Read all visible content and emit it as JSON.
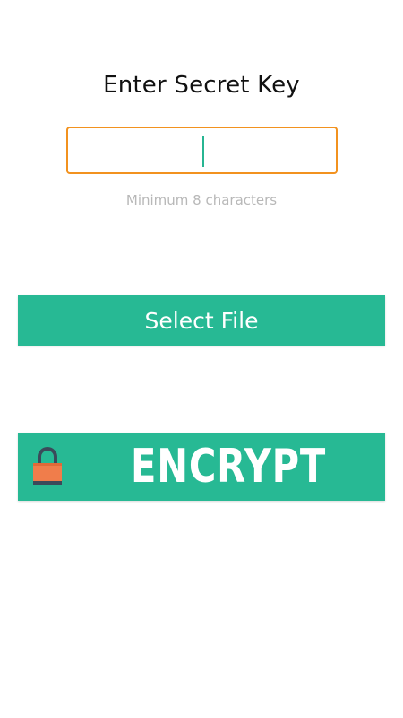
{
  "screen": {
    "title": "Enter Secret Key",
    "key_input": {
      "value": "",
      "placeholder": ""
    },
    "hint": "Minimum 8 characters",
    "select_file_label": "Select File",
    "encrypt_label": "ENCRYPT",
    "encrypt_icon": "padlock-icon"
  },
  "colors": {
    "background": "#ffffff",
    "accent_green": "#27b994",
    "input_border_orange": "#f2921f",
    "lock_body": "#f07d4b",
    "lock_shackle": "#3b4a5a",
    "hint_text": "#b8b8b8"
  }
}
